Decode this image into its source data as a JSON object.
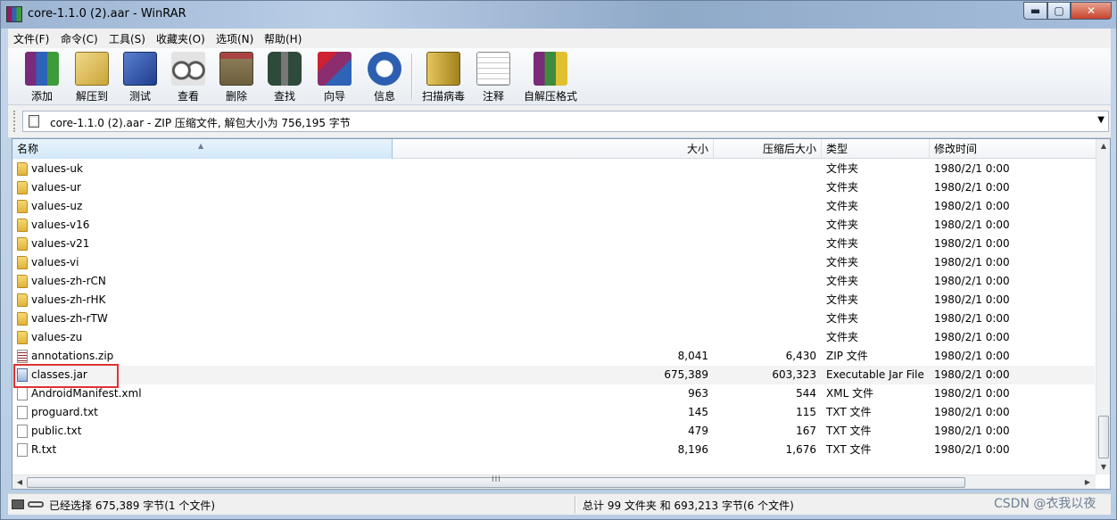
{
  "window": {
    "title": "core-1.1.0 (2).aar - WinRAR",
    "minimize": "▬",
    "maximize": "▢",
    "close": "✕"
  },
  "menu": [
    "文件(F)",
    "命令(C)",
    "工具(S)",
    "收藏夹(O)",
    "选项(N)",
    "帮助(H)"
  ],
  "toolbar": [
    {
      "label": "添加",
      "icon": "add-icon",
      "color": "#7a2b7a"
    },
    {
      "label": "解压到",
      "icon": "extract-to-icon",
      "color": "#c9a537"
    },
    {
      "label": "测试",
      "icon": "test-icon",
      "color": "#2b4fa3"
    },
    {
      "label": "查看",
      "icon": "view-icon",
      "color": "#a3a3a3"
    },
    {
      "label": "删除",
      "icon": "delete-icon",
      "color": "#8a7a55"
    },
    {
      "label": "查找",
      "icon": "find-icon",
      "color": "#3d6e52"
    },
    {
      "label": "向导",
      "icon": "wizard-icon",
      "color": "#8c2d6e"
    },
    {
      "label": "信息",
      "icon": "info-icon",
      "color": "#2c5fb0"
    },
    {
      "label": "扫描病毒",
      "icon": "scan-virus-icon",
      "color": "#c2a23a"
    },
    {
      "label": "注释",
      "icon": "comment-icon",
      "color": "#d9d9d9"
    },
    {
      "label": "自解压格式",
      "icon": "sfx-icon",
      "color": "#3d8c3d"
    }
  ],
  "address": {
    "text": "core-1.1.0 (2).aar - ZIP 压缩文件, 解包大小为 756,195 字节",
    "dropdown": "▼"
  },
  "columns": {
    "name": "名称",
    "size": "大小",
    "packed": "压缩后大小",
    "type": "类型",
    "modified": "修改时间"
  },
  "files": [
    {
      "name": "values-uk",
      "size": "",
      "packed": "",
      "type": "文件夹",
      "modified": "1980/2/1 0:00",
      "kind": "folder"
    },
    {
      "name": "values-ur",
      "size": "",
      "packed": "",
      "type": "文件夹",
      "modified": "1980/2/1 0:00",
      "kind": "folder"
    },
    {
      "name": "values-uz",
      "size": "",
      "packed": "",
      "type": "文件夹",
      "modified": "1980/2/1 0:00",
      "kind": "folder"
    },
    {
      "name": "values-v16",
      "size": "",
      "packed": "",
      "type": "文件夹",
      "modified": "1980/2/1 0:00",
      "kind": "folder"
    },
    {
      "name": "values-v21",
      "size": "",
      "packed": "",
      "type": "文件夹",
      "modified": "1980/2/1 0:00",
      "kind": "folder"
    },
    {
      "name": "values-vi",
      "size": "",
      "packed": "",
      "type": "文件夹",
      "modified": "1980/2/1 0:00",
      "kind": "folder"
    },
    {
      "name": "values-zh-rCN",
      "size": "",
      "packed": "",
      "type": "文件夹",
      "modified": "1980/2/1 0:00",
      "kind": "folder"
    },
    {
      "name": "values-zh-rHK",
      "size": "",
      "packed": "",
      "type": "文件夹",
      "modified": "1980/2/1 0:00",
      "kind": "folder"
    },
    {
      "name": "values-zh-rTW",
      "size": "",
      "packed": "",
      "type": "文件夹",
      "modified": "1980/2/1 0:00",
      "kind": "folder"
    },
    {
      "name": "values-zu",
      "size": "",
      "packed": "",
      "type": "文件夹",
      "modified": "1980/2/1 0:00",
      "kind": "folder"
    },
    {
      "name": "annotations.zip",
      "size": "8,041",
      "packed": "6,430",
      "type": "ZIP 文件",
      "modified": "1980/2/1 0:00",
      "kind": "zip"
    },
    {
      "name": "classes.jar",
      "size": "675,389",
      "packed": "603,323",
      "type": "Executable Jar File",
      "modified": "1980/2/1 0:00",
      "kind": "jar"
    },
    {
      "name": "AndroidManifest.xml",
      "size": "963",
      "packed": "544",
      "type": "XML 文件",
      "modified": "1980/2/1 0:00",
      "kind": "file"
    },
    {
      "name": "proguard.txt",
      "size": "145",
      "packed": "115",
      "type": "TXT 文件",
      "modified": "1980/2/1 0:00",
      "kind": "file"
    },
    {
      "name": "public.txt",
      "size": "479",
      "packed": "167",
      "type": "TXT 文件",
      "modified": "1980/2/1 0:00",
      "kind": "file"
    },
    {
      "name": "R.txt",
      "size": "8,196",
      "packed": "1,676",
      "type": "TXT 文件",
      "modified": "1980/2/1 0:00",
      "kind": "file"
    }
  ],
  "selected_row": 11,
  "status": {
    "left": "已经选择 675,389 字节(1 个文件)",
    "right": "总计 99 文件夹 和 693,213 字节(6 个文件)"
  },
  "watermark": "CSDN @衣我以夜",
  "scroll": {
    "up": "▲",
    "down": "▼",
    "left": "◀",
    "right": "▶",
    "grip": "III"
  }
}
